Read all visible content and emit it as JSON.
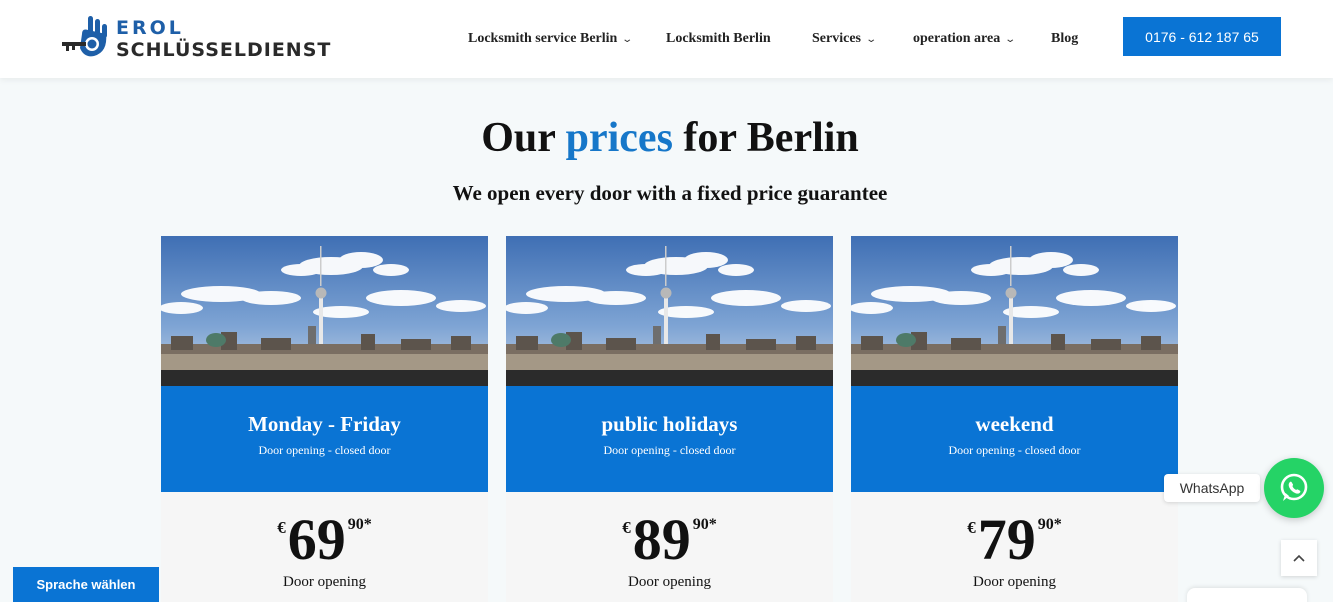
{
  "header": {
    "logo_line1": "EROL",
    "logo_line2": "SCHLÜSSELDIENST",
    "nav": [
      {
        "label": "Locksmith service Berlin",
        "has_dropdown": true
      },
      {
        "label": "Locksmith Berlin",
        "has_dropdown": false
      },
      {
        "label": "Services",
        "has_dropdown": true
      },
      {
        "label": "operation area",
        "has_dropdown": true
      },
      {
        "label": "Blog",
        "has_dropdown": false
      }
    ],
    "phone": "0176 - 612 187 65"
  },
  "hero": {
    "title_pre": "Our",
    "title_accent": "prices",
    "title_post": "for Berlin",
    "subtitle": "We open every door with a fixed price guarantee"
  },
  "cards": [
    {
      "title": "Monday - Friday",
      "subtitle": "Door opening - closed door",
      "currency": "€",
      "amount": "69",
      "cents": "90*",
      "label": "Door opening"
    },
    {
      "title": "public holidays",
      "subtitle": "Door opening - closed door",
      "currency": "€",
      "amount": "89",
      "cents": "90*",
      "label": "Door opening"
    },
    {
      "title": "weekend",
      "subtitle": "Door opening - closed door",
      "currency": "€",
      "amount": "79",
      "cents": "90*",
      "label": "Door opening"
    }
  ],
  "floating": {
    "language_button": "Sprache wählen",
    "whatsapp_label": "WhatsApp",
    "whatsapp_icon": "whatsapp-icon",
    "scroll_top_icon": "chevron-up-icon"
  },
  "colors": {
    "accent": "#0a74d4",
    "title_accent": "#1677c9",
    "whatsapp": "#25d366",
    "background": "#f5f9fa"
  }
}
